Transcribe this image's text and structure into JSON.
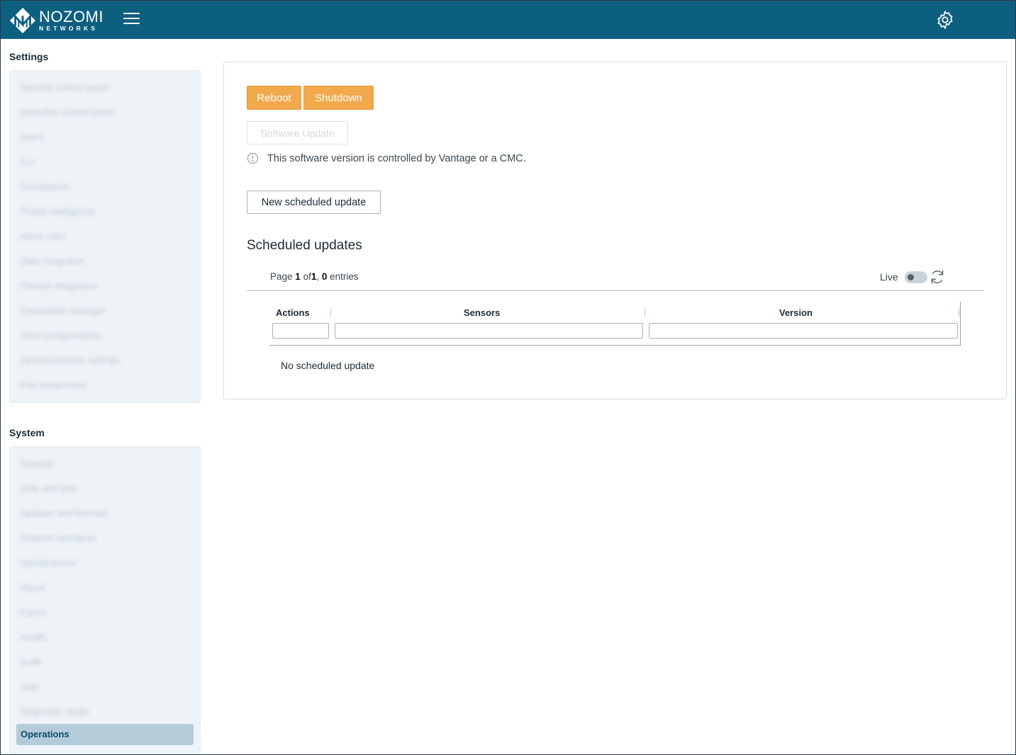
{
  "header": {
    "logo_name": "NOZOMI",
    "logo_sub": "NETWORKS",
    "brand_color": "#0d5f80",
    "menu_icon": "hamburger-icon",
    "settings_icon": "gear-icon"
  },
  "sidebar": {
    "settings_title": "Settings",
    "settings_items": [
      "Security control panel",
      "Detection control panel",
      "Users",
      "CLI",
      "Dashboards",
      "Threat intelligence",
      "Alerts rules",
      "Data integration",
      "Firewall integration",
      "Credentials manager",
      "Zone configurations",
      "Synchronization settings",
      "Port assignment"
    ],
    "system_title": "System",
    "system_items": [
      "General",
      "Date and time",
      "Updates and licenses",
      "Network interfaces",
      "Upload traces",
      "Import",
      "Export",
      "Health",
      "Audit",
      "Jobs",
      "Diagnostic mode"
    ],
    "active_item": "Operations"
  },
  "main": {
    "reboot_label": "Reboot",
    "shutdown_label": "Shutdown",
    "software_update_label": "Software Update",
    "info_text": "This software version is controlled by Vantage or a CMC.",
    "new_update_label": "New scheduled update",
    "scheduled_title": "Scheduled updates",
    "pager": {
      "prefix": "Page",
      "page": "1",
      "of": "of",
      "total_pages": "1",
      "entries_count": "0",
      "entries_label": "entries"
    },
    "live_label": "Live",
    "live_enabled": false,
    "columns": [
      "Actions",
      "Sensors",
      "Version"
    ],
    "empty_text": "No scheduled update",
    "accent_color": "#f1a94c"
  }
}
